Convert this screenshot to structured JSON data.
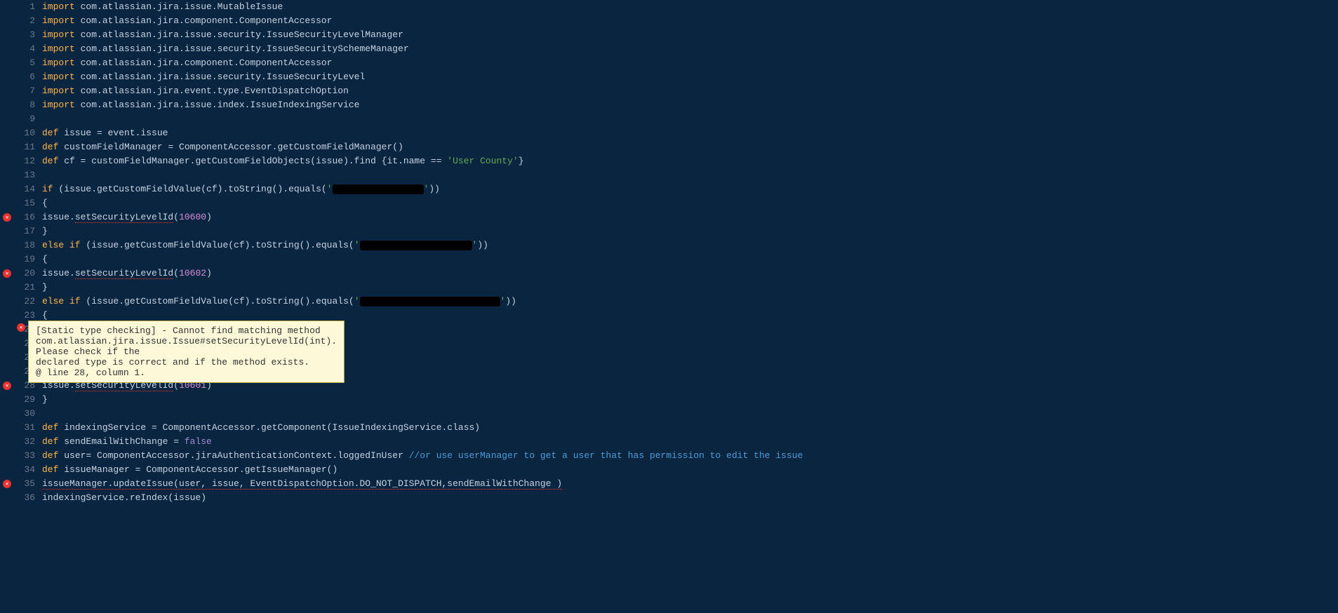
{
  "tooltip": {
    "line1": "[Static type checking] - Cannot find matching method",
    "line2": "com.atlassian.jira.issue.Issue#setSecurityLevelId(int). Please check if the",
    "line3": "declared type is correct and if the method exists.",
    "line4": "@ line 28, column 1."
  },
  "error_markers": [
    16,
    20,
    28,
    35
  ],
  "tooltip_at_line": 24,
  "lines": {
    "l1": {
      "kw": "import",
      "rest": " com.atlassian.jira.issue.MutableIssue"
    },
    "l2": {
      "kw": "import",
      "rest": " com.atlassian.jira.component.ComponentAccessor"
    },
    "l3": {
      "kw": "import",
      "rest": " com.atlassian.jira.issue.security.IssueSecurityLevelManager"
    },
    "l4": {
      "kw": "import",
      "rest": " com.atlassian.jira.issue.security.IssueSecuritySchemeManager"
    },
    "l5": {
      "kw": "import",
      "rest": " com.atlassian.jira.component.ComponentAccessor"
    },
    "l6": {
      "kw": "import",
      "rest": " com.atlassian.jira.issue.security.IssueSecurityLevel"
    },
    "l7": {
      "kw": "import",
      "rest": " com.atlassian.jira.event.type.EventDispatchOption"
    },
    "l8": {
      "kw": "import",
      "rest": " com.atlassian.jira.issue.index.IssueIndexingService"
    },
    "l10": {
      "def": "def",
      "rest": " issue = event.issue"
    },
    "l11": {
      "def": "def",
      "rest": " customFieldManager = ComponentAccessor.getCustomFieldManager()"
    },
    "l12": {
      "def": "def",
      "pre": " cf = customFieldManager.getCustomFieldObjects(issue).find {it.name == ",
      "str": "'User County'",
      "post": "}"
    },
    "l14": {
      "kw": "if",
      "pre": " (issue.getCustomFieldValue(cf).toString().equals(",
      "strq": "'",
      "redactw": 130,
      "post": "))"
    },
    "l15": {
      "txt": "{"
    },
    "l16": {
      "pre": "issue.",
      "err": "setSecurityLevelId",
      "open": "(",
      "num": "10600",
      "close": ")"
    },
    "l17": {
      "txt": "}"
    },
    "l18": {
      "kw": "else if",
      "pre": " (issue.getCustomFieldValue(cf).toString().equals(",
      "strq": "'",
      "redactw": 160,
      "post": "))"
    },
    "l19": {
      "txt": "{"
    },
    "l20": {
      "pre": "issue.",
      "err": "setSecurityLevelId",
      "open": "(",
      "num": "10602",
      "close": ")"
    },
    "l21": {
      "txt": "}"
    },
    "l22": {
      "kw": "else if",
      "pre": " (issue.getCustomFieldValue(cf).toString().equals(",
      "strq": "'",
      "redactw": 200,
      "post": "))"
    },
    "l23": {
      "txt": "{"
    },
    "l28": {
      "pre": "issue.",
      "err": "setSecurityLevelId",
      "open": "(",
      "num": "10601",
      "close": ")"
    },
    "l29": {
      "txt": "}"
    },
    "l31": {
      "def": "def",
      "rest": " indexingService = ComponentAccessor.getComponent(IssueIndexingService.class)"
    },
    "l32": {
      "def": "def",
      "pre": " sendEmailWithChange = ",
      "bool": "false"
    },
    "l33": {
      "def": "def",
      "rest": " user= ComponentAccessor.jiraAuthenticationContext.loggedInUser ",
      "comment": "//or use userManager to get a user that has permission to edit the issue"
    },
    "l34": {
      "def": "def",
      "rest": " issueManager = ComponentAccessor.getIssueManager()"
    },
    "l35": {
      "err": "issueManager.updateIssue(user, issue, EventDispatchOption.DO_NOT_DISPATCH,sendEmailWithChange )"
    },
    "l36": {
      "txt": "indexingService.reIndex(issue)"
    }
  },
  "line_count": 36
}
